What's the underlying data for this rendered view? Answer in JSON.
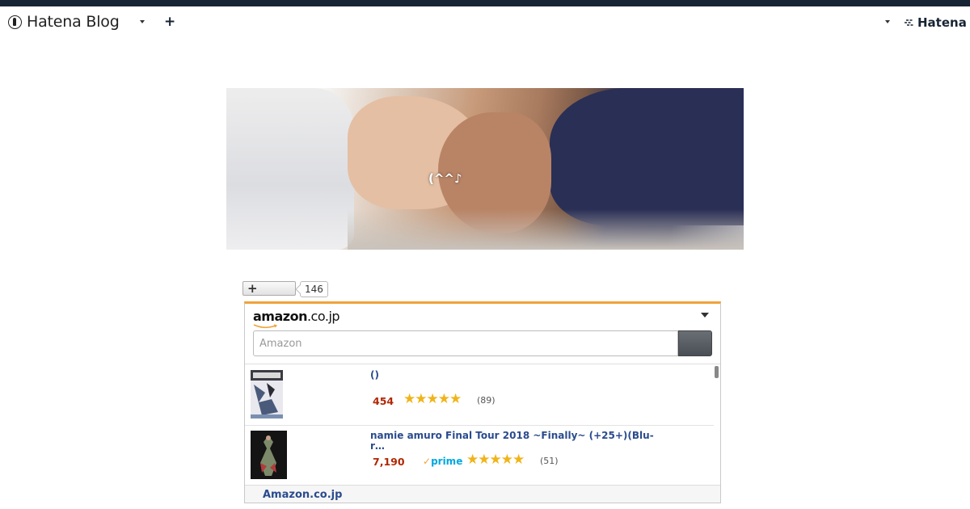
{
  "globalnav": {
    "logo_text": "Hatena Blog",
    "add_label": "+",
    "hatena_label": "Hatena"
  },
  "header": {
    "blog_title": "(^^♪"
  },
  "star": {
    "add_label": "+",
    "count": "146"
  },
  "amazon_widget": {
    "logo_main": "amazon",
    "logo_suffix": ".co.jp",
    "search_placeholder": "Amazon",
    "items": [
      {
        "name": "()",
        "price": "454",
        "rating": 4.5,
        "stars": "★★★★★",
        "reviews": "(89)",
        "prime": false
      },
      {
        "name": "namie amuro Final Tour 2018 ~Finally~ (+25+)(Blu-r…",
        "price": "7,190",
        "rating": 4.5,
        "stars": "★★★★★",
        "reviews": "(51)",
        "prime": true,
        "prime_label": "prime"
      }
    ],
    "footer_link": "Amazon.co.jp"
  },
  "colors": {
    "topband": "#172433",
    "amazon_orange": "#f0a33b",
    "link_blue": "#2a4b8d",
    "price_red": "#b12704",
    "star_gold": "#f0b41a"
  }
}
